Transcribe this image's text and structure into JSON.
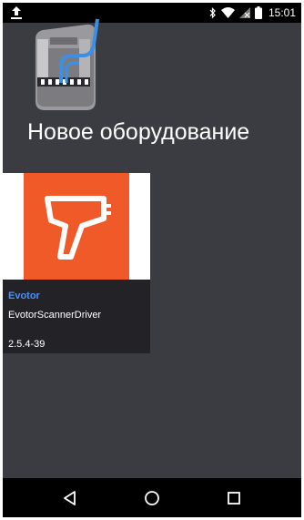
{
  "status_bar": {
    "time": "15:01",
    "icons": [
      "upload-icon",
      "bluetooth-icon",
      "wifi-icon",
      "no-signal-icon",
      "battery-icon"
    ]
  },
  "main": {
    "illustration_icon": "scanner-device-illustration",
    "title": "Новое оборудование"
  },
  "card": {
    "icon": "barcode-scanner-icon",
    "accent_color": "#f05a28",
    "vendor": "Evotor",
    "name": "EvotorScannerDriver",
    "version": "2.5.4-39"
  },
  "nav_bar": {
    "buttons": [
      "back-icon",
      "home-icon",
      "recents-icon"
    ]
  }
}
